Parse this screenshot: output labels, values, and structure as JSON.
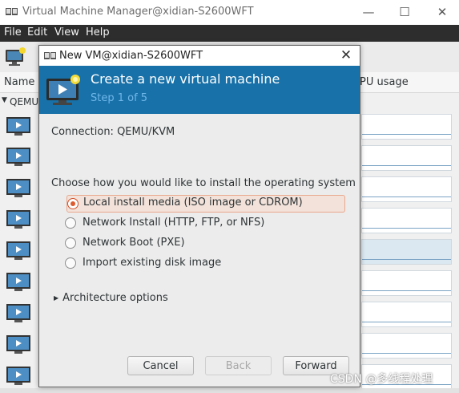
{
  "main_window": {
    "title": "Virtual Machine Manager@xidian-S2600WFT",
    "menu": [
      "File",
      "Edit",
      "View",
      "Help"
    ],
    "columns": {
      "name": "Name",
      "cpu": "PU usage"
    },
    "group": "QEMU/"
  },
  "dialog": {
    "title": "New VM@xidian-S2600WFT",
    "heading": "Create a new virtual machine",
    "step": "Step 1 of 5",
    "connection": "Connection:  QEMU/KVM",
    "prompt": "Choose how you would like to install the operating system",
    "options": [
      {
        "label": "Local install media (ISO image or CDROM)",
        "selected": true
      },
      {
        "label": "Network Install (HTTP, FTP, or NFS)",
        "selected": false
      },
      {
        "label": "Network Boot (PXE)",
        "selected": false
      },
      {
        "label": "Import existing disk image",
        "selected": false
      }
    ],
    "architecture": "Architecture options",
    "buttons": {
      "cancel": "Cancel",
      "back": "Back",
      "forward": "Forward"
    }
  },
  "watermark": "CSDN @多线程处理",
  "colors": {
    "banner": "#1871a8",
    "accent": "#dd5b2f",
    "menubar": "#2d2d2d"
  }
}
